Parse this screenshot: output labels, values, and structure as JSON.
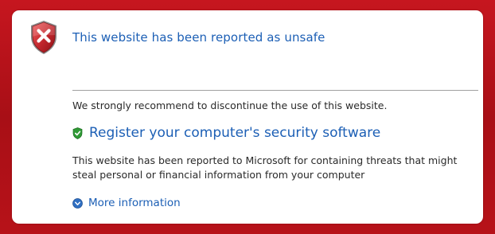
{
  "colors": {
    "background_red": "#b5121b",
    "panel_white": "#ffffff",
    "link_blue": "#1c5fb5",
    "body_text": "#2a2a2a",
    "shield_red": "#c0262c",
    "shield_green": "#2f9a35"
  },
  "header": {
    "icon": "red-shield-x-icon",
    "title": "This website has been reported as unsafe"
  },
  "main": {
    "recommendation": "We strongly recommend to discontinue the use of this website.",
    "register_icon": "green-shield-check-icon",
    "register_link": "Register your computer's security software",
    "threat_description": "This website has been reported to Microsoft for containing threats that might steal personal or financial information from your computer",
    "more_icon": "chevron-down-circle-icon",
    "more_link": "More information"
  }
}
